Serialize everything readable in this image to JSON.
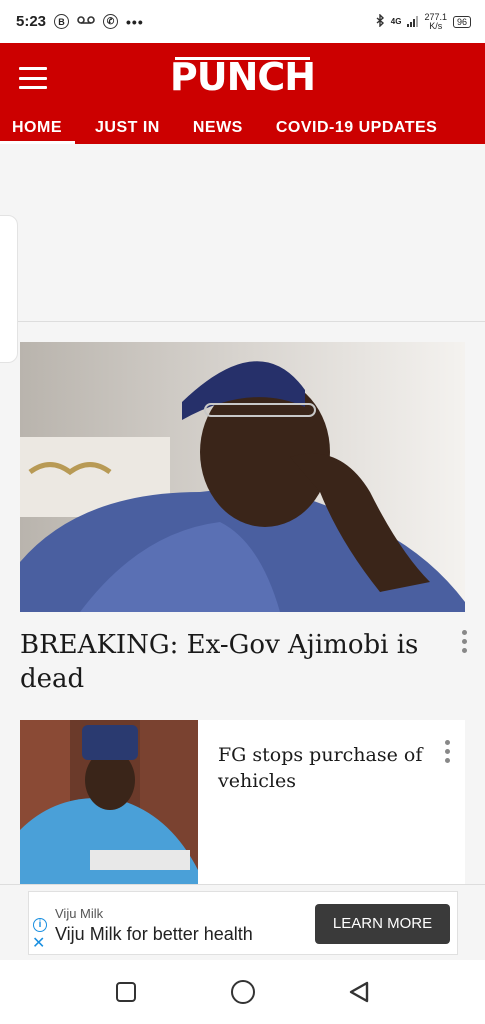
{
  "status_bar": {
    "time": "5:23",
    "icons": [
      "b-icon",
      "voicemail-icon",
      "whatsapp-icon",
      "more-dots-icon",
      "bluetooth-icon",
      "signal-icon"
    ],
    "network_type": "4G",
    "speed_value": "277.1",
    "speed_unit": "K/s",
    "battery": "96"
  },
  "header": {
    "logo": "PUNCH",
    "brand_color": "#cc0000"
  },
  "nav": {
    "items": [
      {
        "label": "HOME"
      },
      {
        "label": "JUST IN"
      },
      {
        "label": "NEWS"
      },
      {
        "label": "COVID-19 UPDATES"
      }
    ]
  },
  "main_story": {
    "title": "BREAKING: Ex-Gov Ajimobi is dead"
  },
  "second_story": {
    "title": "FG stops purchase of vehicles"
  },
  "ad": {
    "brand": "Viju Milk",
    "text": "Viju Milk for better health",
    "cta": "LEARN MORE"
  },
  "android_nav": {
    "icons": [
      "recents-square-icon",
      "home-circle-icon",
      "back-triangle-icon"
    ]
  }
}
